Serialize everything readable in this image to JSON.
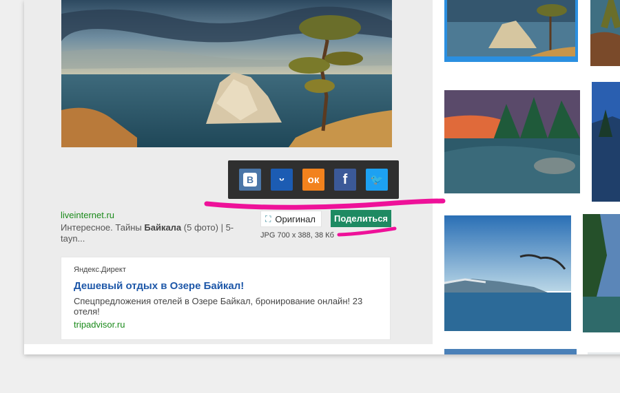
{
  "share": {
    "networks": [
      {
        "name": "vk",
        "glyph": "В",
        "color": "#4a76a8"
      },
      {
        "name": "moimir",
        "glyph": "ᵕ",
        "color": "#1c5cb3"
      },
      {
        "name": "odnoklassniki",
        "glyph": "ок",
        "color": "#f2821d"
      },
      {
        "name": "facebook",
        "glyph": "f",
        "color": "#3b5998"
      },
      {
        "name": "twitter",
        "glyph": "🐦",
        "color": "#1da1f2"
      }
    ]
  },
  "source": {
    "domain": "liveinternet.ru",
    "desc_prefix": "Интересное. Тайны ",
    "desc_bold": "Байкала",
    "desc_suffix": " (5 фото) | 5-tayn..."
  },
  "actions": {
    "original_label": "Оригинал",
    "share_label": "Поделиться"
  },
  "image_info": "JPG 700 x 388, 38 Кб",
  "ad": {
    "label": "Яндекс.Директ",
    "title": "Дешевый отдых в Озере Байкал!",
    "description": "Спецпредложения отелей в Озере Байкал, бронирование онлайн! 23 отеля!",
    "link": "tripadvisor.ru"
  },
  "colors": {
    "share_button": "#1e8a62",
    "selected_border": "#2b8fe0",
    "annotation": "#ee1199"
  }
}
